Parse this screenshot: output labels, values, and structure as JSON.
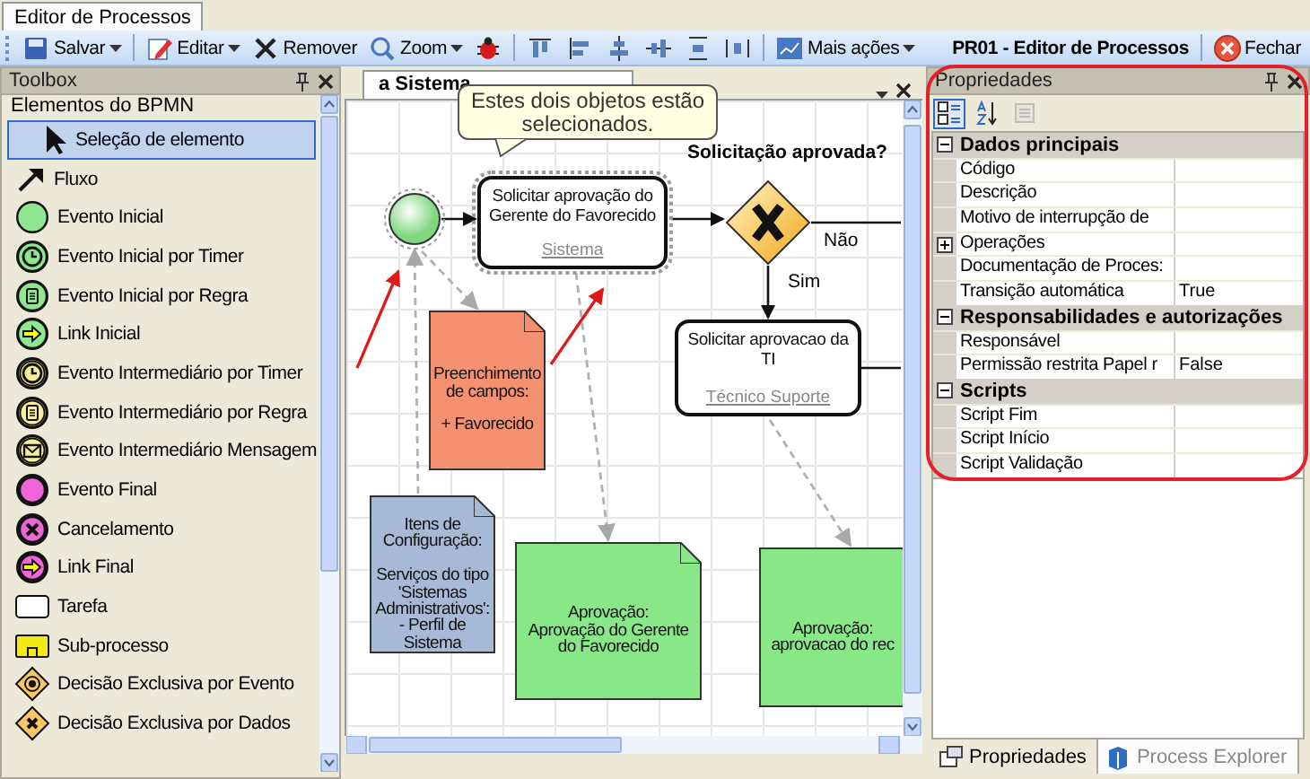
{
  "document_tabs": [
    {
      "label": "Editor de Processos",
      "selected": true
    }
  ],
  "toolbar": {
    "buttons": [
      {
        "kind": "save",
        "label": "Salvar",
        "dropdown": true
      },
      {
        "kind": "edit",
        "label": "Editar",
        "dropdown": true
      },
      {
        "kind": "remove",
        "label": "Remover",
        "dropdown": false
      },
      {
        "kind": "zoom",
        "label": "Zoom",
        "dropdown": true
      },
      {
        "kind": "debug",
        "dropdown": false
      },
      {
        "kind": "align-top",
        "dropdown": false
      },
      {
        "kind": "align-left",
        "dropdown": false
      },
      {
        "kind": "align-center",
        "dropdown": false
      },
      {
        "kind": "align-middle",
        "dropdown": false
      },
      {
        "kind": "distribute-vertical",
        "dropdown": false
      },
      {
        "kind": "distribute-horizontal",
        "dropdown": false
      },
      {
        "kind": "more",
        "label": "Mais ações",
        "dropdown": true
      }
    ],
    "title": "PR01 - Editor de Processos",
    "close_label": "Fechar"
  },
  "toolbox": {
    "title": "Toolbox",
    "category": "Elementos do BPMN",
    "items": [
      {
        "kind": "pointer",
        "label": "Seleção de elemento",
        "selected": true
      },
      {
        "kind": "flow",
        "label": "Fluxo",
        "selected": false
      },
      {
        "kind": "start",
        "label": "Evento Inicial",
        "selected": false
      },
      {
        "kind": "start-timer",
        "label": "Evento Inicial por Timer",
        "selected": false
      },
      {
        "kind": "start-rule",
        "label": "Evento Inicial por Regra",
        "selected": false
      },
      {
        "kind": "start-link",
        "label": "Link Inicial",
        "selected": false
      },
      {
        "kind": "mid-timer",
        "label": "Evento Intermediário por Timer",
        "selected": false
      },
      {
        "kind": "mid-rule",
        "label": "Evento Intermediário por Regra",
        "selected": false
      },
      {
        "kind": "mid-message",
        "label": "Evento Intermediário Mensagem",
        "selected": false
      },
      {
        "kind": "end",
        "label": "Evento Final",
        "selected": false
      },
      {
        "kind": "end-cancel",
        "label": "Cancelamento",
        "selected": false
      },
      {
        "kind": "end-link",
        "label": "Link Final",
        "selected": false
      },
      {
        "kind": "task",
        "label": "Tarefa",
        "selected": false
      },
      {
        "kind": "subprocess",
        "label": "Sub-processo",
        "selected": false
      },
      {
        "kind": "gateway-event",
        "label": "Decisão Exclusiva por Evento",
        "selected": false
      },
      {
        "kind": "gateway-data",
        "label": "Decisão Exclusiva por Dados",
        "selected": false
      }
    ]
  },
  "editor": {
    "tab_label": "a Sistema",
    "tooltip": "Estes dois objetos estão selecionados.",
    "diagram": {
      "title": "Solicitação aprovada?",
      "nodes": [
        {
          "kind": "start",
          "selected": true
        },
        {
          "kind": "task",
          "text": "Solicitar aprovação do Gerente do Favorecido",
          "performer": "Sistema",
          "selected": true
        },
        {
          "kind": "gateway",
          "selected": false
        },
        {
          "kind": "task",
          "text": "Solicitar aprovacao da TI",
          "performer": "Técnico Suporte",
          "selected": false
        },
        {
          "kind": "note",
          "text": "Preenchimento de campos:\n\n+ Favorecido",
          "color": "#f59071"
        },
        {
          "kind": "note",
          "text": "Itens de Configuração:\n\nServiços do tipo 'Sistemas Administrativos': - Perfil de Sistema",
          "color": "#a7b9d6"
        },
        {
          "kind": "note",
          "text": "Aprovação:\nAprovação do Gerente do Favorecido",
          "color": "#88e888"
        },
        {
          "kind": "note",
          "text": "Aprovação:\naprovacao do rec",
          "color": "#88e888"
        }
      ],
      "labels": [
        "Não",
        "Sim"
      ]
    }
  },
  "properties": {
    "title": "Propriedades",
    "tools": [
      {
        "kind": "categorized",
        "selected": true
      },
      {
        "kind": "alphabetical",
        "selected": false
      },
      {
        "kind": "pages",
        "disabled": true
      }
    ],
    "groups": [
      {
        "name": "Dados principais",
        "expanded": true,
        "rows": [
          {
            "name": "Código"
          },
          {
            "name": "Descrição"
          },
          {
            "name": "Motivo de interrupção de"
          },
          {
            "name": "Operações",
            "expanded": false
          },
          {
            "name": "Documentação de Proces:"
          },
          {
            "name": "Transição automática",
            "value": "True"
          }
        ]
      },
      {
        "name": "Responsabilidades e autorizações",
        "expanded": true,
        "rows": [
          {
            "name": "Responsável"
          },
          {
            "name": "Permissão restrita Papel r",
            "value": "False"
          }
        ]
      },
      {
        "name": "Scripts",
        "expanded": true,
        "rows": [
          {
            "name": "Script Fim"
          },
          {
            "name": "Script Início"
          },
          {
            "name": "Script Validação"
          }
        ]
      }
    ]
  },
  "bottom_tabs": [
    {
      "label": "Propriedades",
      "selected": true
    },
    {
      "label": "Process Explorer",
      "selected": false
    }
  ]
}
